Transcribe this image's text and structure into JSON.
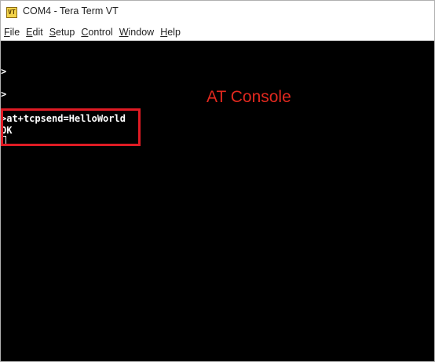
{
  "window": {
    "title": "COM4 - Tera Term VT",
    "icon_label": "VT"
  },
  "menu": {
    "items": [
      {
        "label": "File",
        "accel": "F",
        "rest": "ile"
      },
      {
        "label": "Edit",
        "accel": "E",
        "rest": "dit"
      },
      {
        "label": "Setup",
        "accel": "S",
        "rest": "etup"
      },
      {
        "label": "Control",
        "accel": "C",
        "rest": "ontrol"
      },
      {
        "label": "Window",
        "accel": "W",
        "rest": "indow"
      },
      {
        "label": "Help",
        "accel": "H",
        "rest": "elp"
      }
    ]
  },
  "terminal": {
    "lines": [
      ">",
      ">",
      ">at+tcpsend=HelloWorld",
      "OK"
    ],
    "background": "#000000",
    "foreground": "#ffffff"
  },
  "annotation": {
    "text": "AT Console",
    "color": "#e0281e"
  },
  "highlight": {
    "color": "#e01b24"
  }
}
